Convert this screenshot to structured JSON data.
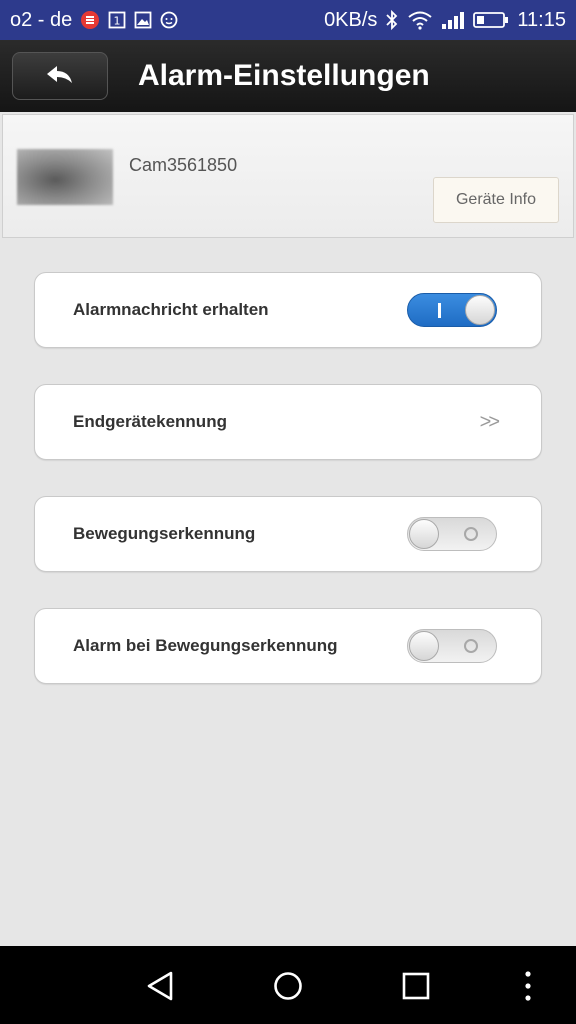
{
  "status_bar": {
    "carrier": "o2 - de",
    "network_speed": "0KB/s",
    "time": "11:15",
    "icons_left": [
      "carrier-app-icon",
      "sim-icon",
      "image-icon",
      "android-icon"
    ],
    "icons_right": [
      "bluetooth-icon",
      "wifi-icon",
      "signal-icon",
      "battery-icon"
    ]
  },
  "header": {
    "title": "Alarm-Einstellungen",
    "back_icon": "back-arrow-icon"
  },
  "device": {
    "name": "Cam3561850",
    "info_button_label": "Geräte Info"
  },
  "settings": [
    {
      "label": "Alarmnachricht erhalten",
      "control": "toggle",
      "enabled": true
    },
    {
      "label": "Endgerätekennung",
      "control": "chevron",
      "chevron_text": ">>"
    },
    {
      "label": "Bewegungserkennung",
      "control": "toggle",
      "enabled": false
    },
    {
      "label": "Alarm bei Bewegungserkennung",
      "control": "toggle",
      "enabled": false
    }
  ],
  "nav_bar": {
    "icons": [
      "back-triangle-icon",
      "home-circle-icon",
      "recents-square-icon",
      "menu-dots-icon"
    ]
  },
  "colors": {
    "status_bar": "#2d3a8c",
    "header": "#1e1e1e",
    "background": "#e6e6e6",
    "toggle_on": "#2a7bd4",
    "nav_bar": "#000000"
  }
}
